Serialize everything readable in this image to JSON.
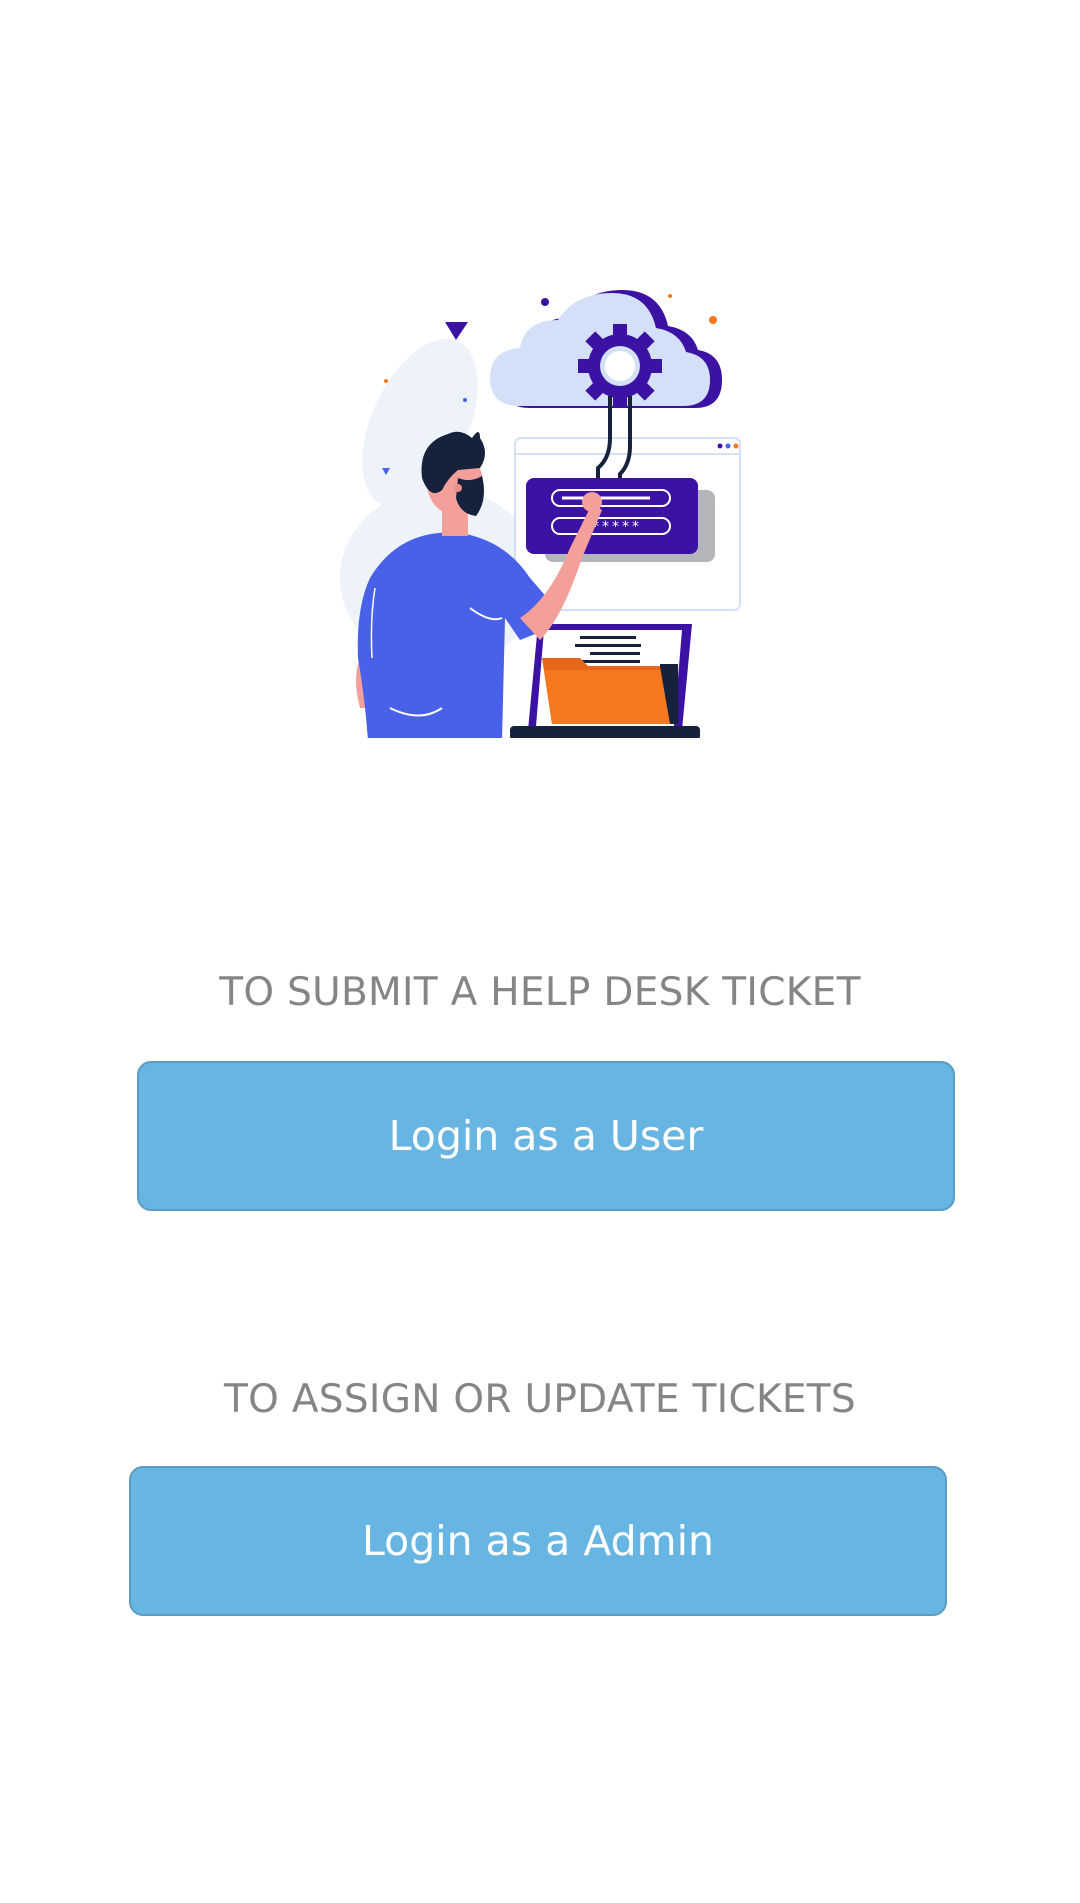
{
  "illustration": {
    "icon": "help-desk-illustration",
    "password_mask": "******",
    "colors": {
      "shirt": "#4861e8",
      "cloud": "#d3e0f7",
      "panel": "#3b12a3",
      "folder": "#f7791f",
      "skin": "#f4a09a",
      "hair": "#16213b"
    }
  },
  "user_section": {
    "caption": "TO SUBMIT A HELP DESK TICKET",
    "button_label": "Login as a User"
  },
  "admin_section": {
    "caption": "TO ASSIGN OR UPDATE TICKETS",
    "button_label": "Login as a Admin"
  },
  "theme": {
    "button_color": "#66b5e2",
    "caption_color": "#858585"
  }
}
